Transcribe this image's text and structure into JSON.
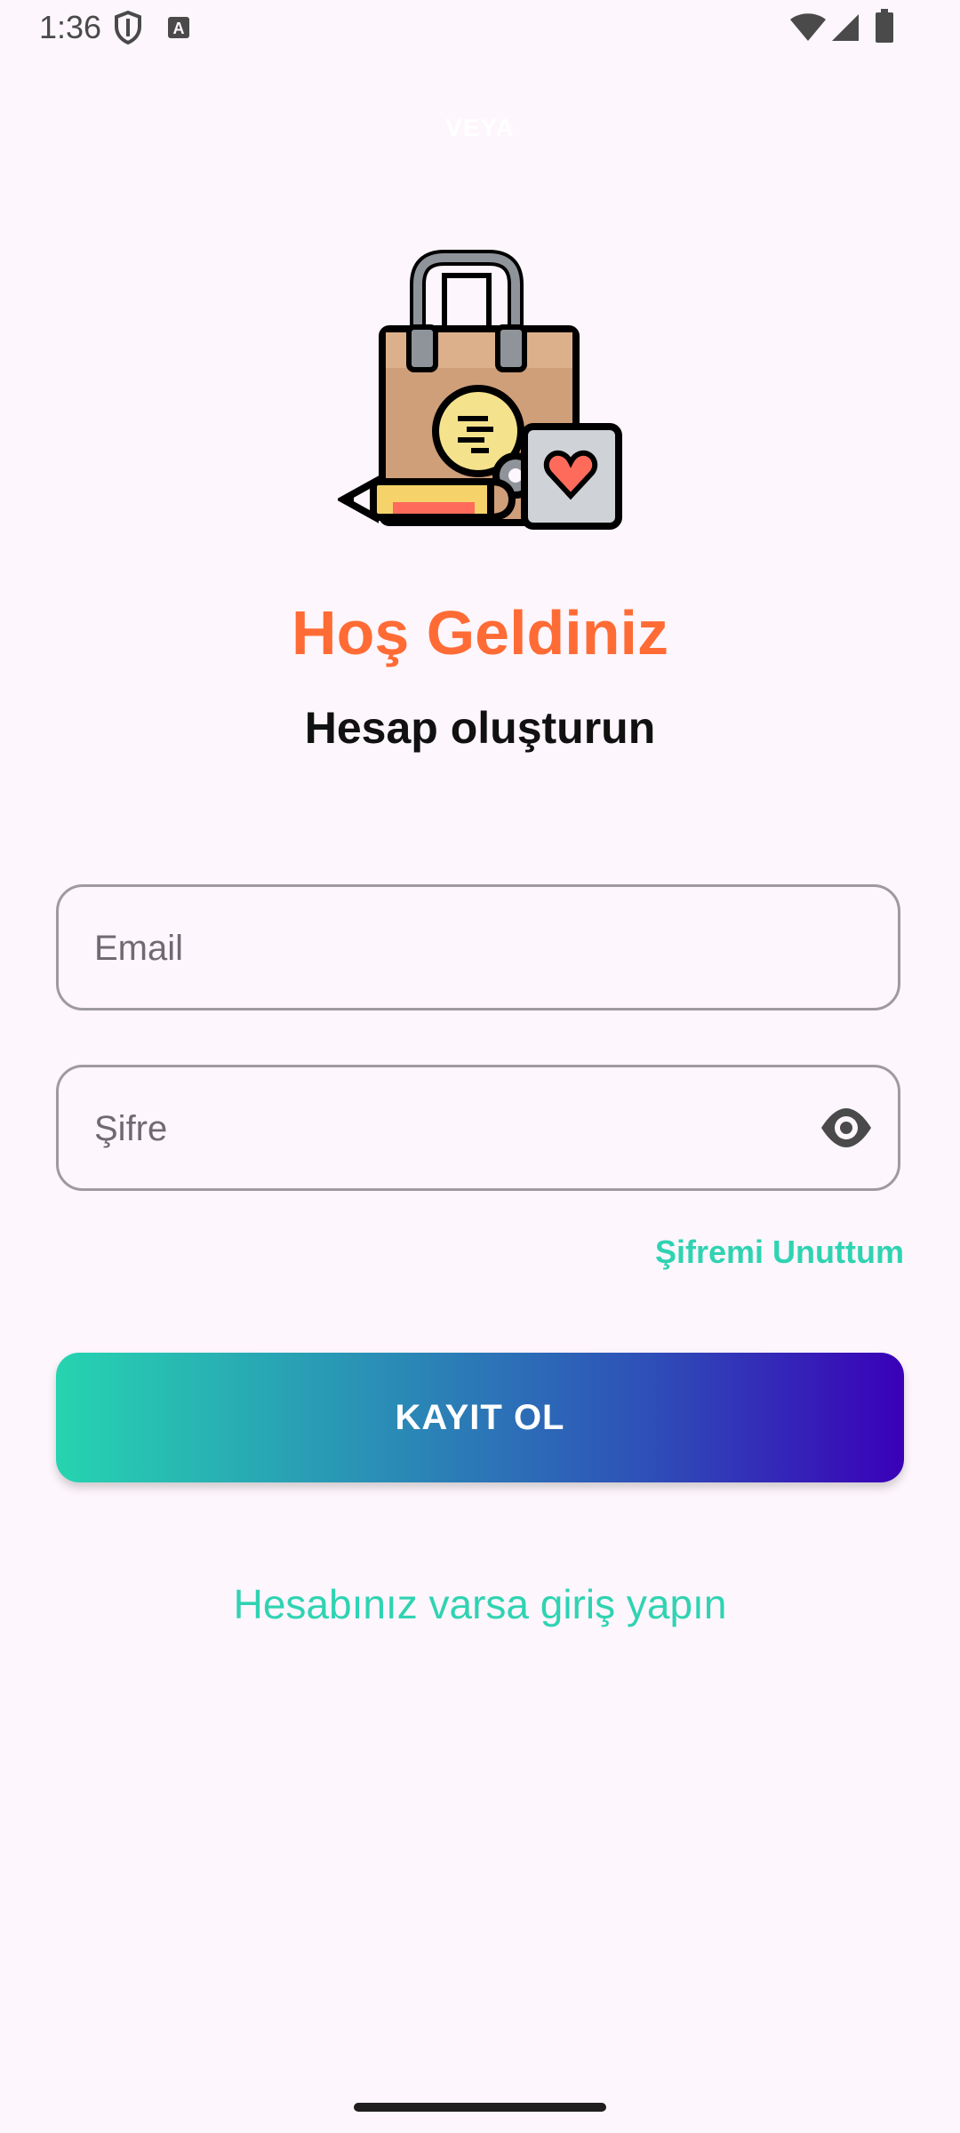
{
  "status_bar": {
    "time": "1:36"
  },
  "header": {
    "veya": "VEYA",
    "title": "Hoş Geldiniz",
    "subtitle": "Hesap oluşturun"
  },
  "form": {
    "email_placeholder": "Email",
    "password_placeholder": "Şifre",
    "forgot_label": "Şifremi Unuttum",
    "register_label": "KAYIT OL",
    "login_link_label": "Hesabınız varsa giriş yapın"
  },
  "colors": {
    "background": "#fdf6fc",
    "title": "#ff6b35",
    "accent": "#2fd3b2",
    "gradient_start": "#26d4b0",
    "gradient_end": "#3a00b8"
  },
  "icons": {
    "logo": "shopping-bag-icon",
    "eye": "eye-icon",
    "shield": "shield-icon",
    "notification": "a-box-icon",
    "wifi": "wifi-icon",
    "signal": "signal-icon",
    "battery": "battery-icon"
  }
}
